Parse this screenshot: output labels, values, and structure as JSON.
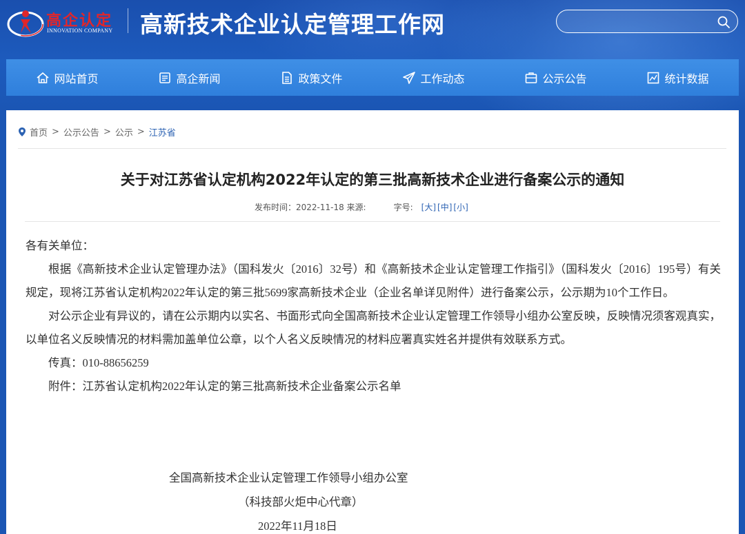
{
  "header": {
    "logo_cn": "高企认定",
    "logo_en": "INNOVATION COMPANY",
    "site_title": "高新技术企业认定管理工作网",
    "search_placeholder": ""
  },
  "nav": [
    {
      "label": "网站首页",
      "icon": "home-icon"
    },
    {
      "label": "高企新闻",
      "icon": "news-icon"
    },
    {
      "label": "政策文件",
      "icon": "document-icon"
    },
    {
      "label": "工作动态",
      "icon": "send-icon"
    },
    {
      "label": "公示公告",
      "icon": "announcement-icon"
    },
    {
      "label": "统计数据",
      "icon": "chart-icon"
    }
  ],
  "breadcrumb": [
    "首页",
    "公示公告",
    "公示",
    "江苏省"
  ],
  "article": {
    "title": "关于对江苏省认定机构2022年认定的第三批高新技术企业进行备案公示的通知",
    "publish": "发布时间：2022-11-18 来源:",
    "font_size_label": "字号:",
    "size_large": "[大]",
    "size_medium": "[中]",
    "size_small": "[小]",
    "salutation": "各有关单位：",
    "para1": "根据《高新技术企业认定管理办法》（国科发火〔2016〕32号）和《高新技术企业认定管理工作指引》（国科发火〔2016〕195号）有关规定，现将江苏省认定机构2022年认定的第三批5699家高新技术企业（企业名单详见附件）进行备案公示，公示期为10个工作日。",
    "para2": "对公示企业有异议的，请在公示期内以实名、书面形式向全国高新技术企业认定管理工作领导小组办公室反映，反映情况须客观真实，以单位名义反映情况的材料需加盖单位公章，以个人名义反映情况的材料应署真实姓名并提供有效联系方式。",
    "fax": "传真：010-88656259",
    "attachment": "附件：江苏省认定机构2022年认定的第三批高新技术企业备案公示名单",
    "signer": "全国高新技术企业认定管理工作领导小组办公室",
    "signer_note": "（科技部火炬中心代章）",
    "date": "2022年11月18日"
  },
  "colors": {
    "brand_blue": "#1b56b4",
    "nav_blue": "#3a8ae4",
    "link_blue": "#2d63b3",
    "logo_red": "#e0262b"
  }
}
